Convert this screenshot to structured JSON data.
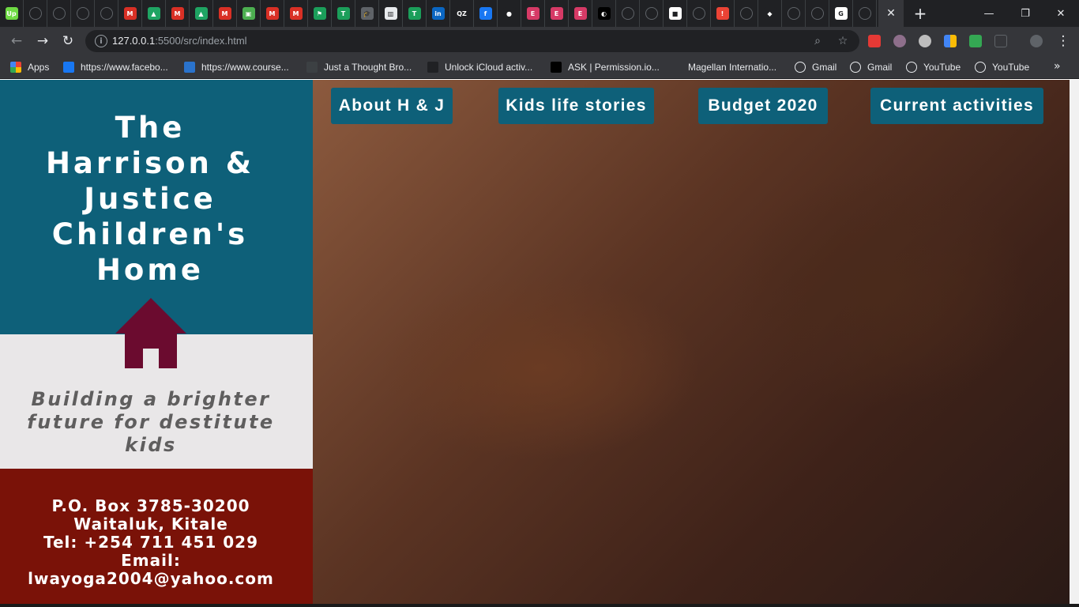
{
  "browser": {
    "tab_favicons": [
      {
        "icon": "upwork-icon",
        "color": "#6fda44",
        "glyph": "Up"
      },
      {
        "icon": "globe-icon",
        "color": "#5f6368",
        "glyph": ""
      },
      {
        "icon": "globe-icon",
        "color": "#5f6368",
        "glyph": ""
      },
      {
        "icon": "globe-icon",
        "color": "#5f6368",
        "glyph": ""
      },
      {
        "icon": "globe-icon",
        "color": "#5f6368",
        "glyph": ""
      },
      {
        "icon": "gmail-icon",
        "color": "#d93025",
        "glyph": "M"
      },
      {
        "icon": "google-drive-icon",
        "color": "#1fa463",
        "glyph": "▲"
      },
      {
        "icon": "gmail-icon",
        "color": "#d93025",
        "glyph": "M"
      },
      {
        "icon": "google-drive-icon",
        "color": "#1fa463",
        "glyph": "▲"
      },
      {
        "icon": "gmail-icon",
        "color": "#d93025",
        "glyph": "M"
      },
      {
        "icon": "screen-icon",
        "color": "#4caf50",
        "glyph": "▣"
      },
      {
        "icon": "gmail-icon",
        "color": "#d93025",
        "glyph": "M"
      },
      {
        "icon": "gmail-icon",
        "color": "#d93025",
        "glyph": "M"
      },
      {
        "icon": "flag-icon",
        "color": "#1b9e5a",
        "glyph": "⚑"
      },
      {
        "icon": "green-t-icon",
        "color": "#1b9e5a",
        "glyph": "T"
      },
      {
        "icon": "graduation-icon",
        "color": "#5f6368",
        "glyph": "🎓"
      },
      {
        "icon": "museum-icon",
        "color": "#e8eaed",
        "glyph": "▥"
      },
      {
        "icon": "green-t-icon",
        "color": "#1b9e5a",
        "glyph": "T"
      },
      {
        "icon": "linkedin-icon",
        "color": "#0a66c2",
        "glyph": "in"
      },
      {
        "icon": "qz-icon",
        "color": "#202124",
        "glyph": "QZ"
      },
      {
        "icon": "facebook-icon",
        "color": "#1877f2",
        "glyph": "f"
      },
      {
        "icon": "github-icon",
        "color": "#202124",
        "glyph": "●"
      },
      {
        "icon": "elementor-icon",
        "color": "#d63a66",
        "glyph": "E"
      },
      {
        "icon": "elementor-icon",
        "color": "#d63a66",
        "glyph": "E"
      },
      {
        "icon": "elementor-icon",
        "color": "#d63a66",
        "glyph": "E"
      },
      {
        "icon": "dark-app-icon",
        "color": "#000000",
        "glyph": "◐"
      },
      {
        "icon": "globe-icon",
        "color": "#5f6368",
        "glyph": ""
      },
      {
        "icon": "globe-icon",
        "color": "#5f6368",
        "glyph": ""
      },
      {
        "icon": "square-icon",
        "color": "#ffffff",
        "glyph": "■"
      },
      {
        "icon": "globe-icon",
        "color": "#5f6368",
        "glyph": ""
      },
      {
        "icon": "alert-icon",
        "color": "#ea4335",
        "glyph": "!"
      },
      {
        "icon": "globe-icon",
        "color": "#5f6368",
        "glyph": ""
      },
      {
        "icon": "diamond-icon",
        "color": "#202124",
        "glyph": "◆"
      },
      {
        "icon": "globe-icon",
        "color": "#5f6368",
        "glyph": ""
      },
      {
        "icon": "globe-icon",
        "color": "#5f6368",
        "glyph": ""
      },
      {
        "icon": "google-icon",
        "color": "#ffffff",
        "glyph": "G"
      },
      {
        "icon": "globe-icon",
        "color": "#5f6368",
        "glyph": ""
      }
    ],
    "active_tab_close": "✕",
    "new_tab": "+",
    "window_controls": {
      "minimize": "—",
      "restore": "❐",
      "close": "✕"
    },
    "nav": {
      "back": "←",
      "forward": "→",
      "reload": "↻"
    },
    "url": {
      "host": "127.0.0.1",
      "rest": ":5500/src/index.html"
    },
    "bookmarks": [
      {
        "label": "Apps",
        "icon": "apps-grid-icon",
        "color": "#ea4335"
      },
      {
        "label": "https://www.facebo...",
        "icon": "facebook-icon",
        "color": "#1877f2"
      },
      {
        "label": "https://www.course...",
        "icon": "coursera-icon",
        "color": "#2a73cc"
      },
      {
        "label": "Just a Thought Bro...",
        "icon": "page-icon",
        "color": "#3c4043"
      },
      {
        "label": "Unlock iCloud activ...",
        "icon": "apple-icon",
        "color": "#202124"
      },
      {
        "label": "ASK | Permission.io...",
        "icon": "p-icon",
        "color": "#000000"
      },
      {
        "label": "Magellan Internatio...",
        "icon": "magellan-icon",
        "color": "#35363a"
      },
      {
        "label": "Gmail",
        "icon": "globe-icon",
        "color": "#5f6368"
      },
      {
        "label": "Gmail",
        "icon": "globe-icon",
        "color": "#5f6368"
      },
      {
        "label": "YouTube",
        "icon": "globe-icon",
        "color": "#5f6368"
      },
      {
        "label": "YouTube",
        "icon": "globe-icon",
        "color": "#5f6368"
      }
    ],
    "bookmarks_more": "»"
  },
  "sidebar": {
    "title_lines": [
      "The",
      "Harrison &",
      "Justice",
      "Children's",
      "Home"
    ],
    "tagline_lines": [
      "Building a brighter",
      "future for destitute kids"
    ],
    "contact_lines": [
      "P.O. Box 3785-30200",
      "Waitaluk, Kitale",
      "Tel: +254 711 451 029",
      "Email:",
      "lwayoga2004@yahoo.com"
    ],
    "colors": {
      "top": "#0e6079",
      "middle": "#e9e7e8",
      "bottom": "#7a1208",
      "house": "#6b0b2f"
    }
  },
  "nav": {
    "about": "About H & J",
    "stories": "Kids life stories",
    "budget": "Budget 2020",
    "activities": "Current activities"
  }
}
